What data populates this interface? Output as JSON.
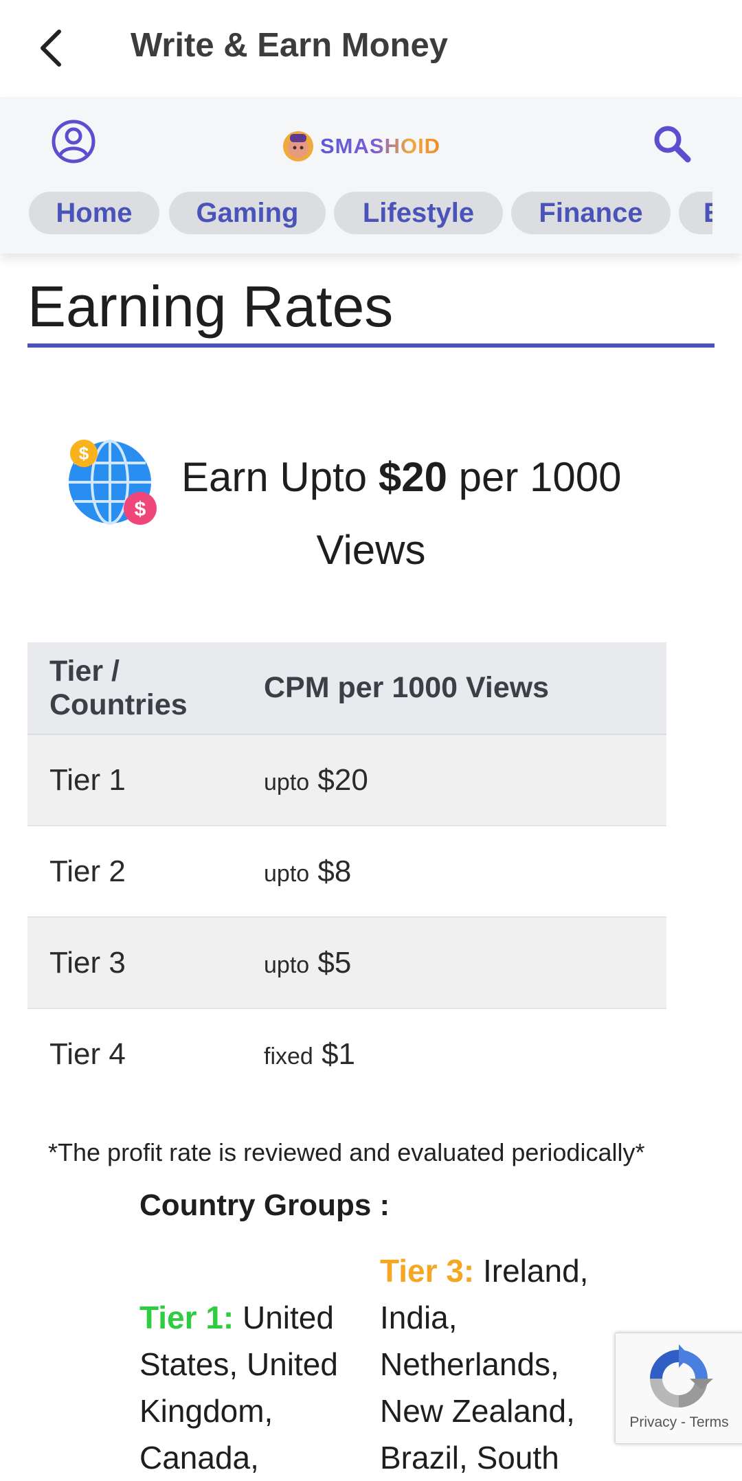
{
  "appbar": {
    "title": "Write & Earn Money"
  },
  "header": {
    "logo_text": "SMASHOID",
    "nav": [
      "Home",
      "Gaming",
      "Lifestyle",
      "Finance",
      "E"
    ]
  },
  "content": {
    "heading": "Earning Rates",
    "earn": {
      "prefix": "Earn Upto ",
      "amount": "$20",
      "suffix": " per 1000",
      "line2": "Views"
    },
    "table": {
      "headers": [
        "Tier / Countries",
        "CPM per 1000 Views"
      ],
      "rows": [
        {
          "tier": "Tier 1",
          "qualifier": "upto",
          "rate": "$20"
        },
        {
          "tier": "Tier 2",
          "qualifier": "upto",
          "rate": "$8"
        },
        {
          "tier": "Tier 3",
          "qualifier": "upto",
          "rate": "$5"
        },
        {
          "tier": "Tier 4",
          "qualifier": "fixed",
          "rate": "$1"
        }
      ]
    },
    "footnote": "*The profit rate is reviewed and evaluated periodically*",
    "groups_title": "Country Groups :",
    "groups": [
      {
        "label": "Tier 1:",
        "countries": "United States, United Kingdom, Canada,",
        "color": "#2ecc40"
      },
      {
        "label": "Tier 3:",
        "countries": "Ireland, India, Netherlands, New Zealand, Brazil, South",
        "color": "#f5a623"
      }
    ]
  },
  "recaptcha": {
    "privacy": "Privacy",
    "separator": " - ",
    "terms": "Terms"
  },
  "colors": {
    "accent": "#4a53b8",
    "pill_bg": "#dcdde1",
    "tier1": "#2ecc40",
    "tier3": "#f5a623"
  }
}
